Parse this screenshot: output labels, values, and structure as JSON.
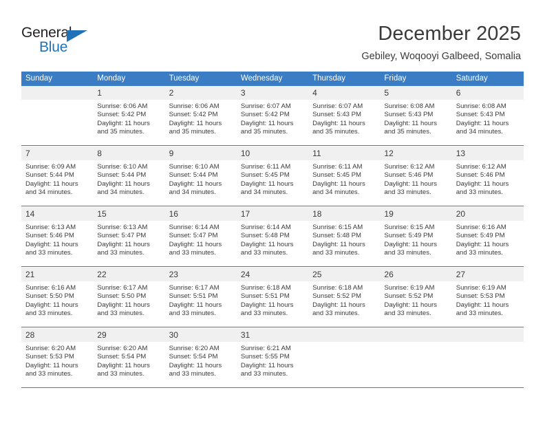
{
  "logo": {
    "line1": "General",
    "line2": "Blue",
    "triangle_icon": "blue-triangle-icon",
    "accent_color": "#1f72b8"
  },
  "header": {
    "title": "December 2025",
    "subtitle": "Gebiley, Woqooyi Galbeed, Somalia"
  },
  "theme": {
    "header_bg": "#3b7dc4",
    "daynum_bg": "#f0f0f0",
    "text": "#3a3a3a"
  },
  "weekday_headers": [
    "Sunday",
    "Monday",
    "Tuesday",
    "Wednesday",
    "Thursday",
    "Friday",
    "Saturday"
  ],
  "weeks": [
    {
      "days": [
        {
          "num": "",
          "sunrise": "",
          "sunset": "",
          "daylight1": "",
          "daylight2": ""
        },
        {
          "num": "1",
          "sunrise": "Sunrise: 6:06 AM",
          "sunset": "Sunset: 5:42 PM",
          "daylight1": "Daylight: 11 hours",
          "daylight2": "and 35 minutes."
        },
        {
          "num": "2",
          "sunrise": "Sunrise: 6:06 AM",
          "sunset": "Sunset: 5:42 PM",
          "daylight1": "Daylight: 11 hours",
          "daylight2": "and 35 minutes."
        },
        {
          "num": "3",
          "sunrise": "Sunrise: 6:07 AM",
          "sunset": "Sunset: 5:42 PM",
          "daylight1": "Daylight: 11 hours",
          "daylight2": "and 35 minutes."
        },
        {
          "num": "4",
          "sunrise": "Sunrise: 6:07 AM",
          "sunset": "Sunset: 5:43 PM",
          "daylight1": "Daylight: 11 hours",
          "daylight2": "and 35 minutes."
        },
        {
          "num": "5",
          "sunrise": "Sunrise: 6:08 AM",
          "sunset": "Sunset: 5:43 PM",
          "daylight1": "Daylight: 11 hours",
          "daylight2": "and 35 minutes."
        },
        {
          "num": "6",
          "sunrise": "Sunrise: 6:08 AM",
          "sunset": "Sunset: 5:43 PM",
          "daylight1": "Daylight: 11 hours",
          "daylight2": "and 34 minutes."
        }
      ]
    },
    {
      "days": [
        {
          "num": "7",
          "sunrise": "Sunrise: 6:09 AM",
          "sunset": "Sunset: 5:44 PM",
          "daylight1": "Daylight: 11 hours",
          "daylight2": "and 34 minutes."
        },
        {
          "num": "8",
          "sunrise": "Sunrise: 6:10 AM",
          "sunset": "Sunset: 5:44 PM",
          "daylight1": "Daylight: 11 hours",
          "daylight2": "and 34 minutes."
        },
        {
          "num": "9",
          "sunrise": "Sunrise: 6:10 AM",
          "sunset": "Sunset: 5:44 PM",
          "daylight1": "Daylight: 11 hours",
          "daylight2": "and 34 minutes."
        },
        {
          "num": "10",
          "sunrise": "Sunrise: 6:11 AM",
          "sunset": "Sunset: 5:45 PM",
          "daylight1": "Daylight: 11 hours",
          "daylight2": "and 34 minutes."
        },
        {
          "num": "11",
          "sunrise": "Sunrise: 6:11 AM",
          "sunset": "Sunset: 5:45 PM",
          "daylight1": "Daylight: 11 hours",
          "daylight2": "and 34 minutes."
        },
        {
          "num": "12",
          "sunrise": "Sunrise: 6:12 AM",
          "sunset": "Sunset: 5:46 PM",
          "daylight1": "Daylight: 11 hours",
          "daylight2": "and 33 minutes."
        },
        {
          "num": "13",
          "sunrise": "Sunrise: 6:12 AM",
          "sunset": "Sunset: 5:46 PM",
          "daylight1": "Daylight: 11 hours",
          "daylight2": "and 33 minutes."
        }
      ]
    },
    {
      "days": [
        {
          "num": "14",
          "sunrise": "Sunrise: 6:13 AM",
          "sunset": "Sunset: 5:46 PM",
          "daylight1": "Daylight: 11 hours",
          "daylight2": "and 33 minutes."
        },
        {
          "num": "15",
          "sunrise": "Sunrise: 6:13 AM",
          "sunset": "Sunset: 5:47 PM",
          "daylight1": "Daylight: 11 hours",
          "daylight2": "and 33 minutes."
        },
        {
          "num": "16",
          "sunrise": "Sunrise: 6:14 AM",
          "sunset": "Sunset: 5:47 PM",
          "daylight1": "Daylight: 11 hours",
          "daylight2": "and 33 minutes."
        },
        {
          "num": "17",
          "sunrise": "Sunrise: 6:14 AM",
          "sunset": "Sunset: 5:48 PM",
          "daylight1": "Daylight: 11 hours",
          "daylight2": "and 33 minutes."
        },
        {
          "num": "18",
          "sunrise": "Sunrise: 6:15 AM",
          "sunset": "Sunset: 5:48 PM",
          "daylight1": "Daylight: 11 hours",
          "daylight2": "and 33 minutes."
        },
        {
          "num": "19",
          "sunrise": "Sunrise: 6:15 AM",
          "sunset": "Sunset: 5:49 PM",
          "daylight1": "Daylight: 11 hours",
          "daylight2": "and 33 minutes."
        },
        {
          "num": "20",
          "sunrise": "Sunrise: 6:16 AM",
          "sunset": "Sunset: 5:49 PM",
          "daylight1": "Daylight: 11 hours",
          "daylight2": "and 33 minutes."
        }
      ]
    },
    {
      "days": [
        {
          "num": "21",
          "sunrise": "Sunrise: 6:16 AM",
          "sunset": "Sunset: 5:50 PM",
          "daylight1": "Daylight: 11 hours",
          "daylight2": "and 33 minutes."
        },
        {
          "num": "22",
          "sunrise": "Sunrise: 6:17 AM",
          "sunset": "Sunset: 5:50 PM",
          "daylight1": "Daylight: 11 hours",
          "daylight2": "and 33 minutes."
        },
        {
          "num": "23",
          "sunrise": "Sunrise: 6:17 AM",
          "sunset": "Sunset: 5:51 PM",
          "daylight1": "Daylight: 11 hours",
          "daylight2": "and 33 minutes."
        },
        {
          "num": "24",
          "sunrise": "Sunrise: 6:18 AM",
          "sunset": "Sunset: 5:51 PM",
          "daylight1": "Daylight: 11 hours",
          "daylight2": "and 33 minutes."
        },
        {
          "num": "25",
          "sunrise": "Sunrise: 6:18 AM",
          "sunset": "Sunset: 5:52 PM",
          "daylight1": "Daylight: 11 hours",
          "daylight2": "and 33 minutes."
        },
        {
          "num": "26",
          "sunrise": "Sunrise: 6:19 AM",
          "sunset": "Sunset: 5:52 PM",
          "daylight1": "Daylight: 11 hours",
          "daylight2": "and 33 minutes."
        },
        {
          "num": "27",
          "sunrise": "Sunrise: 6:19 AM",
          "sunset": "Sunset: 5:53 PM",
          "daylight1": "Daylight: 11 hours",
          "daylight2": "and 33 minutes."
        }
      ]
    },
    {
      "days": [
        {
          "num": "28",
          "sunrise": "Sunrise: 6:20 AM",
          "sunset": "Sunset: 5:53 PM",
          "daylight1": "Daylight: 11 hours",
          "daylight2": "and 33 minutes."
        },
        {
          "num": "29",
          "sunrise": "Sunrise: 6:20 AM",
          "sunset": "Sunset: 5:54 PM",
          "daylight1": "Daylight: 11 hours",
          "daylight2": "and 33 minutes."
        },
        {
          "num": "30",
          "sunrise": "Sunrise: 6:20 AM",
          "sunset": "Sunset: 5:54 PM",
          "daylight1": "Daylight: 11 hours",
          "daylight2": "and 33 minutes."
        },
        {
          "num": "31",
          "sunrise": "Sunrise: 6:21 AM",
          "sunset": "Sunset: 5:55 PM",
          "daylight1": "Daylight: 11 hours",
          "daylight2": "and 33 minutes."
        },
        {
          "num": "",
          "sunrise": "",
          "sunset": "",
          "daylight1": "",
          "daylight2": ""
        },
        {
          "num": "",
          "sunrise": "",
          "sunset": "",
          "daylight1": "",
          "daylight2": ""
        },
        {
          "num": "",
          "sunrise": "",
          "sunset": "",
          "daylight1": "",
          "daylight2": ""
        }
      ]
    }
  ]
}
